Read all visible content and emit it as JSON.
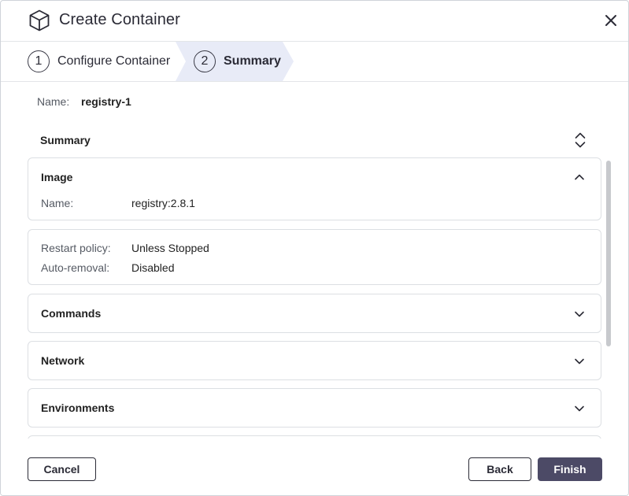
{
  "dialog": {
    "title": "Create Container",
    "icon": "cube-icon",
    "close_icon": "close-icon"
  },
  "stepper": {
    "steps": [
      {
        "number": "1",
        "label": "Configure Container",
        "active": false
      },
      {
        "number": "2",
        "label": "Summary",
        "active": true
      }
    ]
  },
  "container": {
    "name_label": "Name:",
    "name_value": "registry-1"
  },
  "summary": {
    "heading": "Summary",
    "sections": {
      "image": {
        "title": "Image",
        "expanded": true,
        "rows": [
          {
            "label": "Name:",
            "value": "registry:2.8.1"
          }
        ]
      },
      "policy": {
        "rows": [
          {
            "label": "Restart policy:",
            "value": "Unless Stopped"
          },
          {
            "label": "Auto-removal:",
            "value": "Disabled"
          }
        ]
      },
      "commands": {
        "title": "Commands",
        "expanded": false
      },
      "network": {
        "title": "Network",
        "expanded": false
      },
      "environments": {
        "title": "Environments",
        "expanded": false
      }
    }
  },
  "footer": {
    "cancel_label": "Cancel",
    "back_label": "Back",
    "finish_label": "Finish"
  },
  "colors": {
    "primary": "#4c4a66",
    "step_active_bg": "#e8ebf7",
    "border": "#dcdfe3",
    "text": "#222222"
  }
}
